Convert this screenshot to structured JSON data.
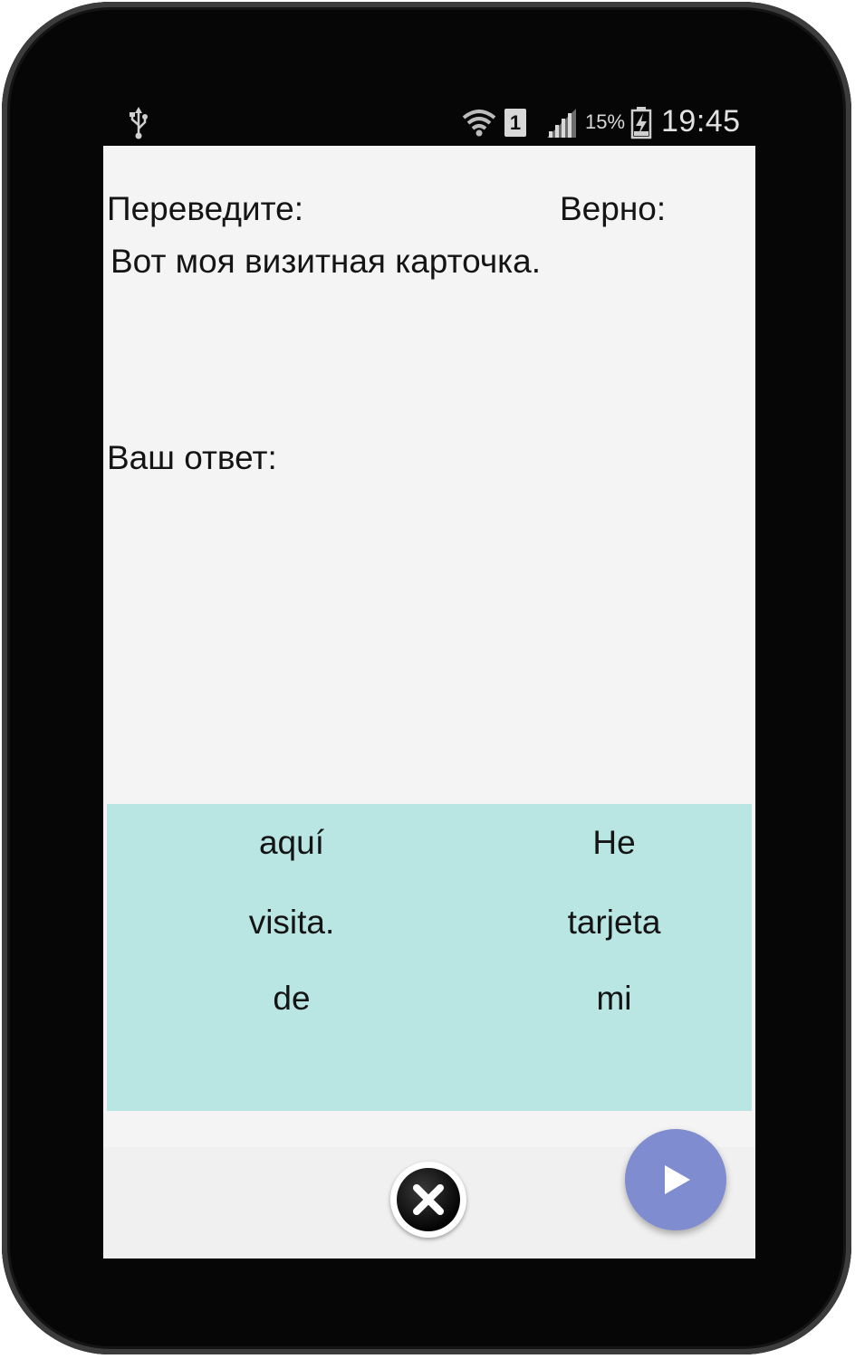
{
  "status_bar": {
    "battery_percent": "15%",
    "time": "19:45",
    "sim_slot": "1",
    "icons": [
      "usb-icon",
      "wifi-icon",
      "sim-icon",
      "signal-icon",
      "battery-charging-icon"
    ]
  },
  "exercise": {
    "translate_label": "Переведите:",
    "correct_label": "Верно:",
    "source_sentence": "Вот моя визитная карточка.",
    "answer_label": "Ваш ответ:"
  },
  "word_tiles": [
    {
      "word": "aquí"
    },
    {
      "word": "He"
    },
    {
      "word": "visita."
    },
    {
      "word": "tarjeta"
    },
    {
      "word": "de"
    },
    {
      "word": "mi"
    }
  ],
  "actions": {
    "close_icon": "close-icon",
    "next_icon": "play-icon",
    "accent_color": "#7f8cd0",
    "tile_area_color": "#b9e6e3"
  }
}
